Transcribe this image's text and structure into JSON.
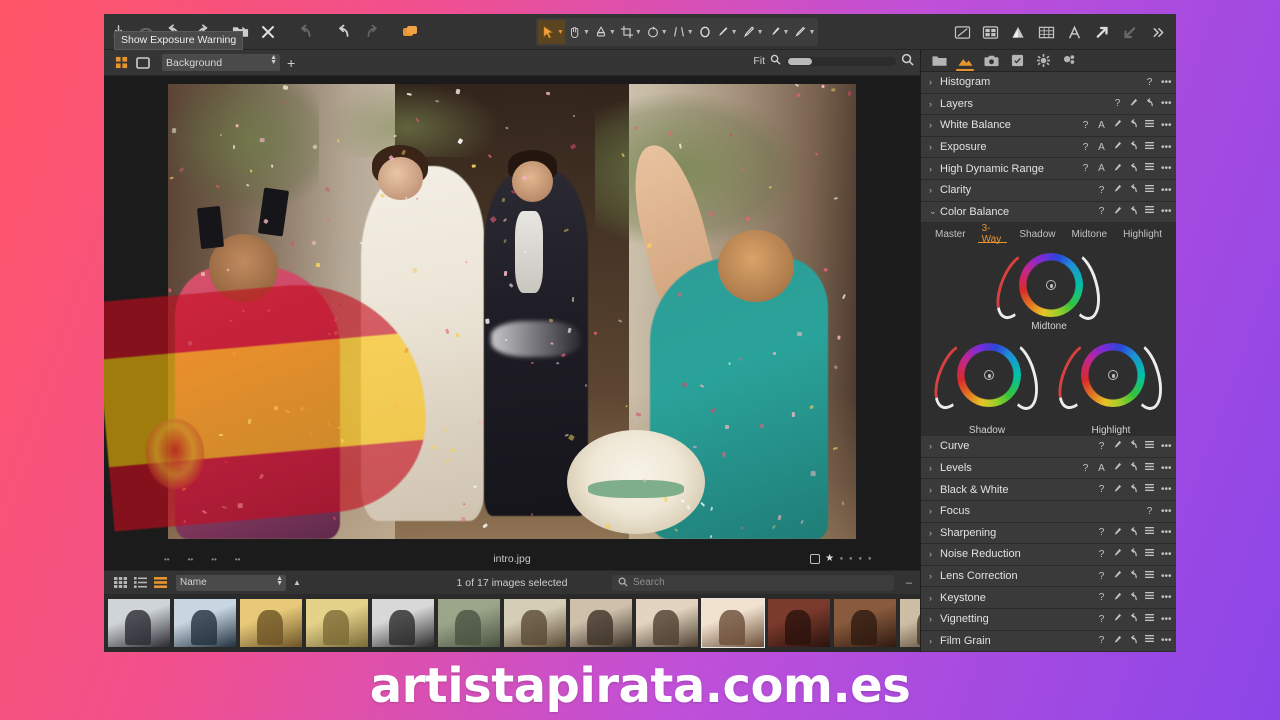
{
  "background": {
    "gradient_start": "#ff5566",
    "gradient_end": "#8b46e8"
  },
  "watermark": {
    "text": "artistapirata.com.es"
  },
  "tooltip": {
    "text": "Show Exposure Warning"
  },
  "top_toolbar": {
    "left_buttons": [
      {
        "name": "import-icon",
        "glyph": "import"
      },
      {
        "name": "import-from-camera-icon",
        "glyph": "camera-tether"
      },
      {
        "name": "undo-arrow-icon",
        "glyph": "undo"
      },
      {
        "name": "redo-arrow-icon",
        "glyph": "redo"
      },
      {
        "name": "open-folder-icon",
        "glyph": "folder-open"
      },
      {
        "name": "close-icon",
        "glyph": "x"
      },
      {
        "name": "reset-icon",
        "glyph": "reset"
      },
      {
        "name": "undo-icon",
        "glyph": "undo2"
      },
      {
        "name": "redo-icon",
        "glyph": "redo2"
      },
      {
        "name": "copy-apply-icon",
        "glyph": "copyapply"
      }
    ],
    "center_tools": [
      {
        "name": "pointer-tool",
        "glyph": "pointer",
        "active": true
      },
      {
        "name": "pan-tool",
        "glyph": "hand"
      },
      {
        "name": "color-picker-tool",
        "glyph": "picker"
      },
      {
        "name": "crop-tool",
        "glyph": "crop"
      },
      {
        "name": "rotate-tool",
        "glyph": "rotate"
      },
      {
        "name": "keystone-tool",
        "glyph": "keystone"
      },
      {
        "name": "ellipse-mask-tool",
        "glyph": "ellipse"
      },
      {
        "name": "brush-tool",
        "glyph": "brush"
      },
      {
        "name": "gradient-mask-tool",
        "glyph": "gradient"
      },
      {
        "name": "eraser-tool",
        "glyph": "eraser"
      },
      {
        "name": "spot-removal-tool",
        "glyph": "pen"
      }
    ],
    "right_tools": [
      {
        "name": "proof-preview-icon",
        "glyph": "proof"
      },
      {
        "name": "compare-variants-icon",
        "glyph": "compare"
      },
      {
        "name": "exposure-warning-icon",
        "glyph": "warning"
      },
      {
        "name": "grid-overlay-icon",
        "glyph": "grid"
      },
      {
        "name": "annotations-icon",
        "glyph": "text-a"
      },
      {
        "name": "cursor-tool-icon",
        "glyph": "arrow-up-right"
      },
      {
        "name": "cursor-tool-alt-icon",
        "glyph": "arrow-down-left"
      },
      {
        "name": "toolbar-overflow-icon",
        "glyph": "chevrons-right"
      }
    ]
  },
  "viewer_bar": {
    "grid_view_icon": "grid-view-icon",
    "single_view_icon": "single-view-icon",
    "layer_value": "Background",
    "add_layer_label": "+",
    "zoom_label": "Fit",
    "zoom_out_icon": "zoom-out-icon",
    "zoom_in_icon": "zoom-in-icon"
  },
  "canvas": {
    "filename": "intro.jpg",
    "rating_stars_filled": 1,
    "rating_stars_total": 5,
    "color_tag_icon": "color-tag-icon"
  },
  "browser_bar": {
    "view_icons": [
      {
        "name": "grid-browser-icon",
        "active": false
      },
      {
        "name": "list-browser-icon",
        "active": false
      },
      {
        "name": "filmstrip-browser-icon",
        "active": true
      }
    ],
    "sort_value": "Name",
    "sort_direction_icon": "sort-ascending-icon",
    "status": "1 of 17 images selected",
    "search_placeholder": "Search",
    "search_icon": "search-icon",
    "collapse_label": "–"
  },
  "filmstrip": {
    "selected_index": 9,
    "thumbnails": [
      {
        "name": "thumbnail-1",
        "c1": "#cfd4d8",
        "c2": "#2b2b33"
      },
      {
        "name": "thumbnail-2",
        "c1": "#c8d6e2",
        "c2": "#23313f"
      },
      {
        "name": "thumbnail-3",
        "c1": "#e8c97a",
        "c2": "#6c5426"
      },
      {
        "name": "thumbnail-4",
        "c1": "#e4d28b",
        "c2": "#7a6a35"
      },
      {
        "name": "thumbnail-5",
        "c1": "#d8d8d8",
        "c2": "#2a2a2a"
      },
      {
        "name": "thumbnail-6",
        "c1": "#9aa58a",
        "c2": "#4a5340"
      },
      {
        "name": "thumbnail-7",
        "c1": "#d6cdb6",
        "c2": "#5a4a33"
      },
      {
        "name": "thumbnail-8",
        "c1": "#cfc0ab",
        "c2": "#3d3228"
      },
      {
        "name": "thumbnail-9",
        "c1": "#e2d4c0",
        "c2": "#4e3f30"
      },
      {
        "name": "thumbnail-10",
        "c1": "#f0e2cf",
        "c2": "#6b4d38"
      },
      {
        "name": "thumbnail-11",
        "c1": "#7a3a2c",
        "c2": "#2a120c"
      },
      {
        "name": "thumbnail-12",
        "c1": "#8a5a3c",
        "c2": "#2e1a10"
      },
      {
        "name": "thumbnail-13",
        "c1": "#cdbda5",
        "c2": "#4a3828"
      }
    ]
  },
  "right_panel": {
    "tabs": [
      {
        "name": "library-tab",
        "glyph": "folder",
        "active": false
      },
      {
        "name": "adjustments-tab",
        "glyph": "image",
        "active": true
      },
      {
        "name": "camera-tab",
        "glyph": "camera",
        "active": false
      },
      {
        "name": "metadata-tab",
        "glyph": "metadata",
        "active": false
      },
      {
        "name": "output-tab",
        "glyph": "gear",
        "active": false
      },
      {
        "name": "batch-tab",
        "glyph": "batch",
        "active": false
      }
    ],
    "tools_top": [
      {
        "name": "Histogram",
        "expanded": false,
        "icons": [
          "?",
          "..."
        ]
      },
      {
        "name": "Layers",
        "expanded": false,
        "icons": [
          "?",
          "pick",
          "reset",
          "..."
        ]
      },
      {
        "name": "White Balance",
        "expanded": false,
        "icons": [
          "?",
          "A",
          "pick",
          "reset",
          "menu",
          "..."
        ]
      },
      {
        "name": "Exposure",
        "expanded": false,
        "icons": [
          "?",
          "A",
          "pick",
          "reset",
          "menu",
          "..."
        ]
      },
      {
        "name": "High Dynamic Range",
        "expanded": false,
        "icons": [
          "?",
          "A",
          "pick",
          "reset",
          "menu",
          "..."
        ]
      },
      {
        "name": "Clarity",
        "expanded": false,
        "icons": [
          "?",
          "pick",
          "reset",
          "menu",
          "..."
        ]
      },
      {
        "name": "Color Balance",
        "expanded": true,
        "icons": [
          "?",
          "pick",
          "reset",
          "menu",
          "..."
        ]
      }
    ],
    "color_balance": {
      "tabs": [
        {
          "label": "Master",
          "active": false
        },
        {
          "label": "3-Way",
          "active": true
        },
        {
          "label": "Shadow",
          "active": false
        },
        {
          "label": "Midtone",
          "active": false
        },
        {
          "label": "Highlight",
          "active": false
        }
      ],
      "wheels": [
        {
          "label": "Midtone",
          "name": "midtone-color-wheel"
        },
        {
          "label": "Shadow",
          "name": "shadow-color-wheel"
        },
        {
          "label": "Highlight",
          "name": "highlight-color-wheel"
        }
      ]
    },
    "tools_bottom": [
      {
        "name": "Curve",
        "expanded": false,
        "icons": [
          "?",
          "pick",
          "reset",
          "menu",
          "..."
        ]
      },
      {
        "name": "Levels",
        "expanded": false,
        "icons": [
          "?",
          "A",
          "pick",
          "reset",
          "menu",
          "..."
        ]
      },
      {
        "name": "Black & White",
        "expanded": false,
        "icons": [
          "?",
          "pick",
          "reset",
          "menu",
          "..."
        ]
      },
      {
        "name": "Focus",
        "expanded": false,
        "icons": [
          "?",
          "..."
        ]
      },
      {
        "name": "Sharpening",
        "expanded": false,
        "icons": [
          "?",
          "pick",
          "reset",
          "menu",
          "..."
        ]
      },
      {
        "name": "Noise Reduction",
        "expanded": false,
        "icons": [
          "?",
          "pick",
          "reset",
          "menu",
          "..."
        ]
      },
      {
        "name": "Lens Correction",
        "expanded": false,
        "icons": [
          "?",
          "pick",
          "reset",
          "menu",
          "..."
        ]
      },
      {
        "name": "Keystone",
        "expanded": false,
        "icons": [
          "?",
          "pick",
          "reset",
          "menu",
          "..."
        ]
      },
      {
        "name": "Vignetting",
        "expanded": false,
        "icons": [
          "?",
          "pick",
          "reset",
          "menu",
          "..."
        ]
      },
      {
        "name": "Film Grain",
        "expanded": false,
        "icons": [
          "?",
          "pick",
          "reset",
          "menu",
          "..."
        ]
      }
    ]
  },
  "colors": {
    "accent_orange": "#e8952f",
    "panel_bg": "#2b2b2b",
    "row_bg": "#3a3a3a",
    "toolbar_bg": "#333333"
  }
}
